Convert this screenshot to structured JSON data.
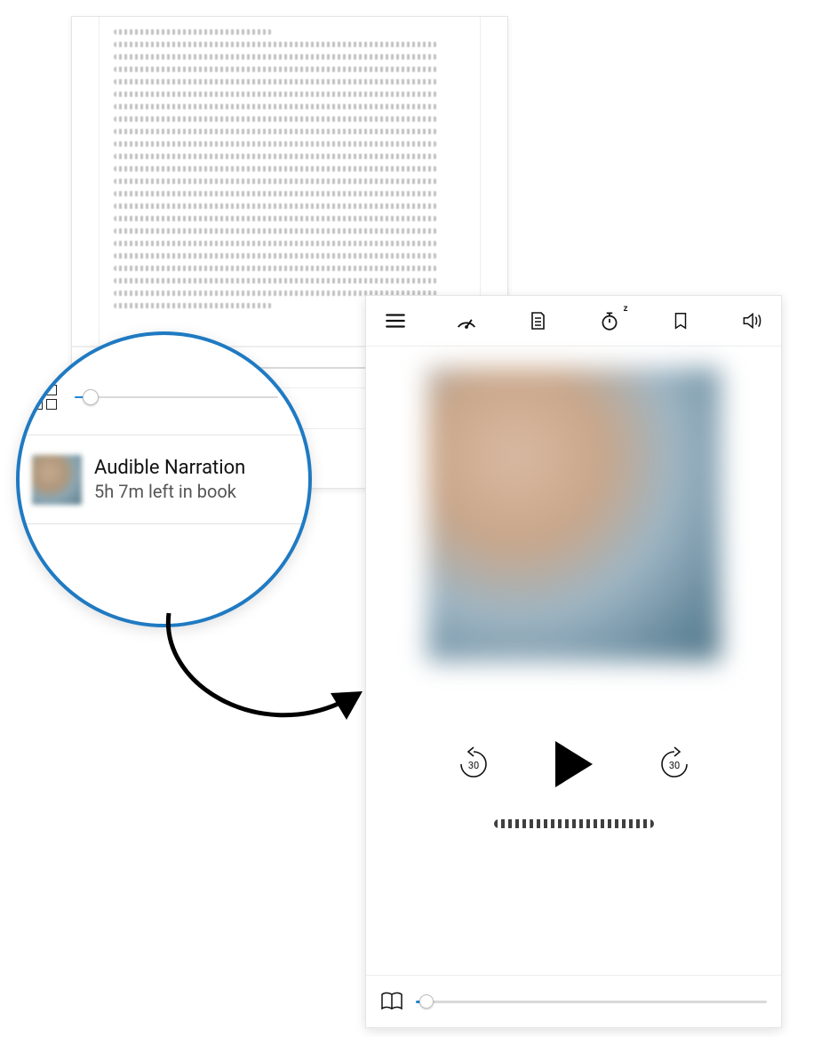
{
  "reader": {
    "progress_slider_pct": 5,
    "narration": {
      "title": "Audible Narration",
      "subtitle": "5h 7m left in book"
    }
  },
  "lens": {
    "progress_slider_pct": 8,
    "narration_title": "Audible Narration",
    "narration_subtitle": "5h 7m left in book"
  },
  "player": {
    "toolbar_icons": [
      "menu",
      "speed",
      "contents",
      "sleep-timer",
      "bookmark",
      "volume"
    ],
    "skip_back_seconds": "30",
    "skip_fwd_seconds": "30",
    "progress_pct": 3
  },
  "colors": {
    "accent": "#1f7ac2"
  }
}
